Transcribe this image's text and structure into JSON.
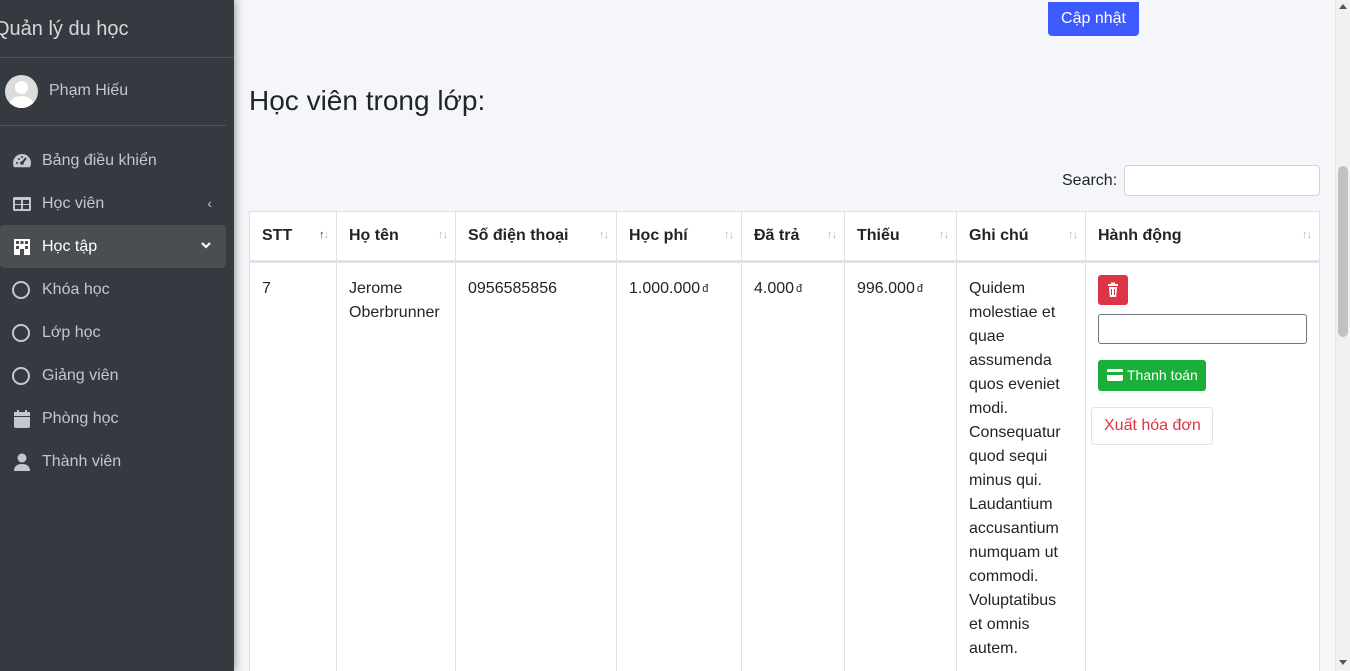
{
  "sidebar": {
    "brand": "Quản lý du học",
    "user_name": "Phạm Hiếu",
    "items": [
      {
        "label": "Bảng điều khiển",
        "icon": "dashboard-icon"
      },
      {
        "label": "Học viên",
        "icon": "table-icon",
        "arrow": "‹"
      },
      {
        "label": "Học tập",
        "icon": "building-icon",
        "arrow": "⌄",
        "active": true
      },
      {
        "label": "Khóa học",
        "icon": "circle-icon"
      },
      {
        "label": "Lớp học",
        "icon": "circle-icon"
      },
      {
        "label": "Giảng viên",
        "icon": "circle-icon"
      },
      {
        "label": "Phòng học",
        "icon": "calendar-icon"
      },
      {
        "label": "Thành viên",
        "icon": "user-icon"
      }
    ]
  },
  "main": {
    "update_button": "Cập nhật",
    "title": "Học viên trong lớp:",
    "search_label": "Search:",
    "search_value": ""
  },
  "table": {
    "columns": [
      "STT",
      "Họ tên",
      "Số điện thoại",
      "Học phí",
      "Đã trả",
      "Thiếu",
      "Ghi chú",
      "Hành động"
    ],
    "rows": [
      {
        "stt": "7",
        "name": "Jerome Oberbrunner",
        "phone": "0956585856",
        "fee": "1.000.000",
        "paid": "4.000",
        "missing": "996.000",
        "currency": "đ",
        "note": "Quidem molestiae et quae assumenda quos eveniet modi. Consequatur quod sequi minus qui. Laudantium accusantium numquam ut commodi. Voluptatibus et omnis autem."
      }
    ],
    "actions": {
      "pay_button": "Thanh toán",
      "invoice_button": "Xuất hóa đơn",
      "payment_value": ""
    }
  },
  "colors": {
    "sidebar_bg": "#343a40",
    "primary": "#3d5afe",
    "danger": "#dc3545",
    "success": "#1cae3b"
  }
}
